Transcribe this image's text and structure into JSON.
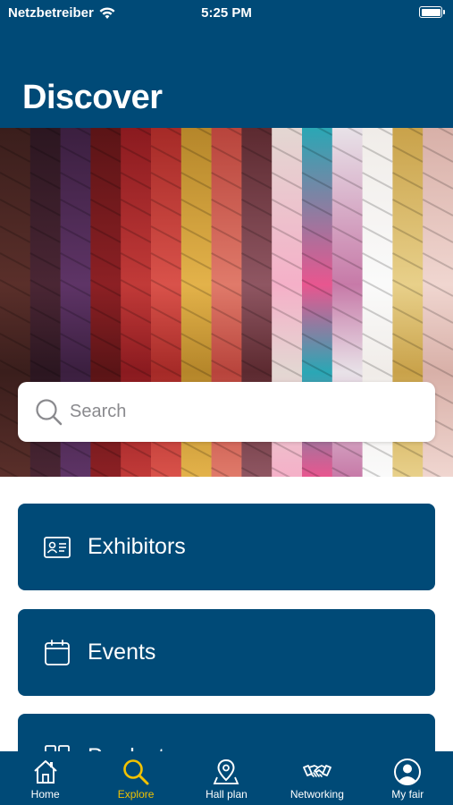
{
  "status_bar": {
    "carrier": "Netzbetreiber",
    "time": "5:25 PM"
  },
  "header": {
    "title": "Discover",
    "color": "#004a77"
  },
  "search": {
    "placeholder": "Search"
  },
  "cards": [
    {
      "label": "Exhibitors",
      "icon": "id-card-icon"
    },
    {
      "label": "Events",
      "icon": "calendar-icon"
    },
    {
      "label": "Products",
      "icon": "grid-icon"
    }
  ],
  "tabs": [
    {
      "label": "Home",
      "icon": "home-icon",
      "active": false
    },
    {
      "label": "Explore",
      "icon": "search-icon",
      "active": true
    },
    {
      "label": "Hall plan",
      "icon": "map-pin-icon",
      "active": false
    },
    {
      "label": "Networking",
      "icon": "handshake-icon",
      "active": false
    },
    {
      "label": "My fair",
      "icon": "user-icon",
      "active": false
    }
  ],
  "colors": {
    "brand": "#004a77",
    "active_tab": "#f2c200"
  }
}
